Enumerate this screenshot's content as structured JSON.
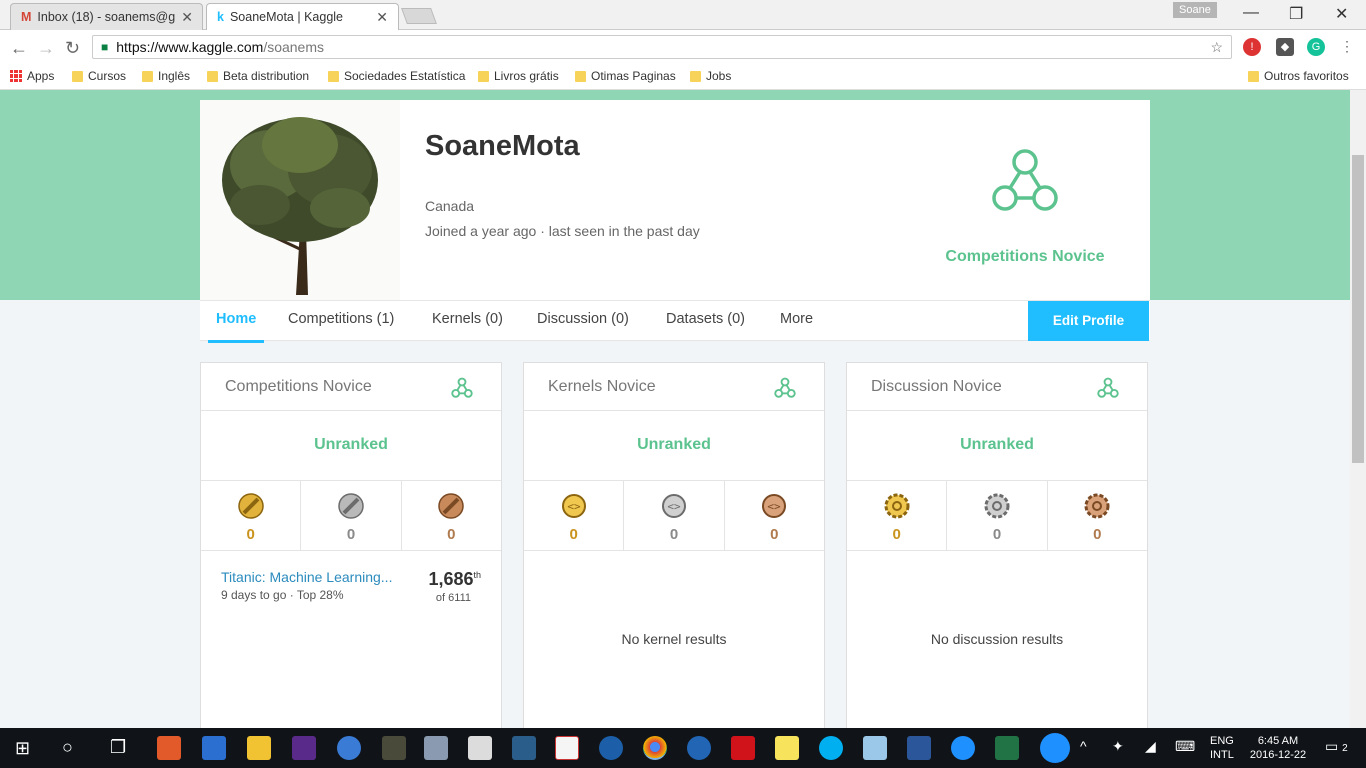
{
  "browser": {
    "tabs": [
      {
        "title": "Inbox (18) - soanems@g",
        "icon": "gmail-icon"
      },
      {
        "title": "SoaneMota | Kaggle",
        "icon": "kaggle-icon"
      }
    ],
    "profile": "Soane",
    "url_host": "https://www.kaggle.com",
    "url_path": "/soanems",
    "bookmarks": [
      "Apps",
      "Cursos",
      "Inglês",
      "Beta distribution",
      "Sociedades Estatística",
      "Livros grátis",
      "Otimas Paginas",
      "Jobs"
    ],
    "bookmarks_other": "Outros favoritos"
  },
  "profile": {
    "name": "SoaneMota",
    "location": "Canada",
    "joined": "Joined a year ago · last seen in the past day",
    "tier": "Competitions Novice",
    "tier_color": "#5cc38f"
  },
  "nav": {
    "items": [
      "Home",
      "Competitions (1)",
      "Kernels (0)",
      "Discussion (0)",
      "Datasets (0)",
      "More"
    ],
    "edit": "Edit Profile",
    "accent": "#20beff"
  },
  "panels": [
    {
      "title": "Competitions Novice",
      "rank": "Unranked",
      "medals": [
        "0",
        "0",
        "0"
      ],
      "entry": {
        "title": "Titanic: Machine Learning...",
        "sub": "9 days to go · Top 28%",
        "rank": "1,686",
        "suffix": "th",
        "of": "of 6111"
      }
    },
    {
      "title": "Kernels Novice",
      "rank": "Unranked",
      "medals": [
        "0",
        "0",
        "0"
      ],
      "empty": "No kernel results"
    },
    {
      "title": "Discussion Novice",
      "rank": "Unranked",
      "medals": [
        "0",
        "0",
        "0"
      ],
      "empty": "No discussion results"
    }
  ],
  "taskbar": {
    "lang1": "ENG",
    "lang2": "INTL",
    "time": "6:45 AM",
    "date": "2016-12-22",
    "notifications": "2"
  }
}
